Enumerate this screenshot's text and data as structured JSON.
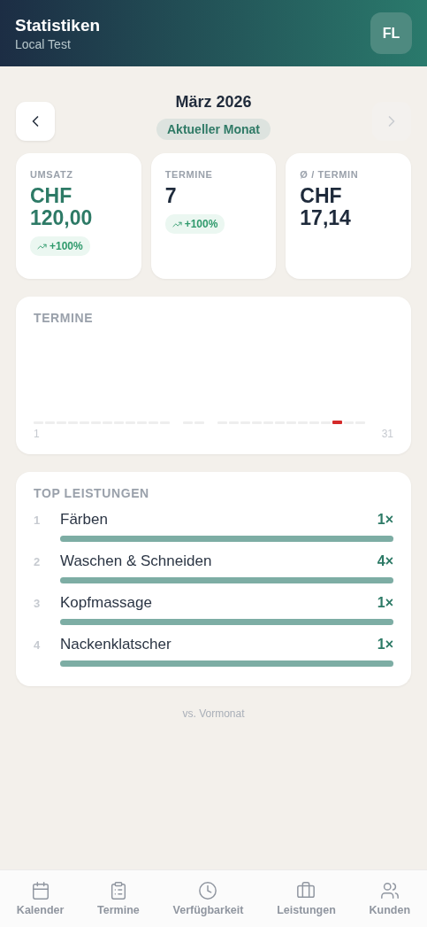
{
  "header": {
    "title": "Statistiken",
    "subtitle": "Local Test",
    "avatar": "FL"
  },
  "month_nav": {
    "title": "März 2026",
    "badge": "Aktueller Monat",
    "prev_disabled": false,
    "next_disabled": true
  },
  "stats": [
    {
      "label": "UMSATZ",
      "value": "CHF 120,00",
      "accent": true,
      "trend": "+100%"
    },
    {
      "label": "TERMINE",
      "value": "7",
      "accent": false,
      "trend": "+100%"
    },
    {
      "label": "Ø / TERMIN",
      "value": "CHF 17,14",
      "accent": false
    }
  ],
  "chart": {
    "title": "TERMINE",
    "axis_start": "1",
    "axis_end": "31"
  },
  "top_services": {
    "title": "TOP LEISTUNGEN",
    "items": [
      {
        "rank": "1",
        "name": "Färben",
        "count": "1×",
        "level": 1
      },
      {
        "rank": "2",
        "name": "Waschen & Schneiden",
        "count": "4×",
        "level": 1
      },
      {
        "rank": "3",
        "name": "Kopfmassage",
        "count": "1×",
        "level": 1
      },
      {
        "rank": "4",
        "name": "Nackenklatscher",
        "count": "1×",
        "level": 1
      }
    ]
  },
  "footnote": "vs. Vormonat",
  "bottom_nav": [
    {
      "kind": "calendar",
      "label": "Kalender"
    },
    {
      "kind": "clipboard",
      "label": "Termine"
    },
    {
      "kind": "clock",
      "label": "Verfügbarkeit"
    },
    {
      "kind": "briefcase",
      "label": "Leistungen"
    },
    {
      "kind": "users",
      "label": "Kunden"
    }
  ]
}
